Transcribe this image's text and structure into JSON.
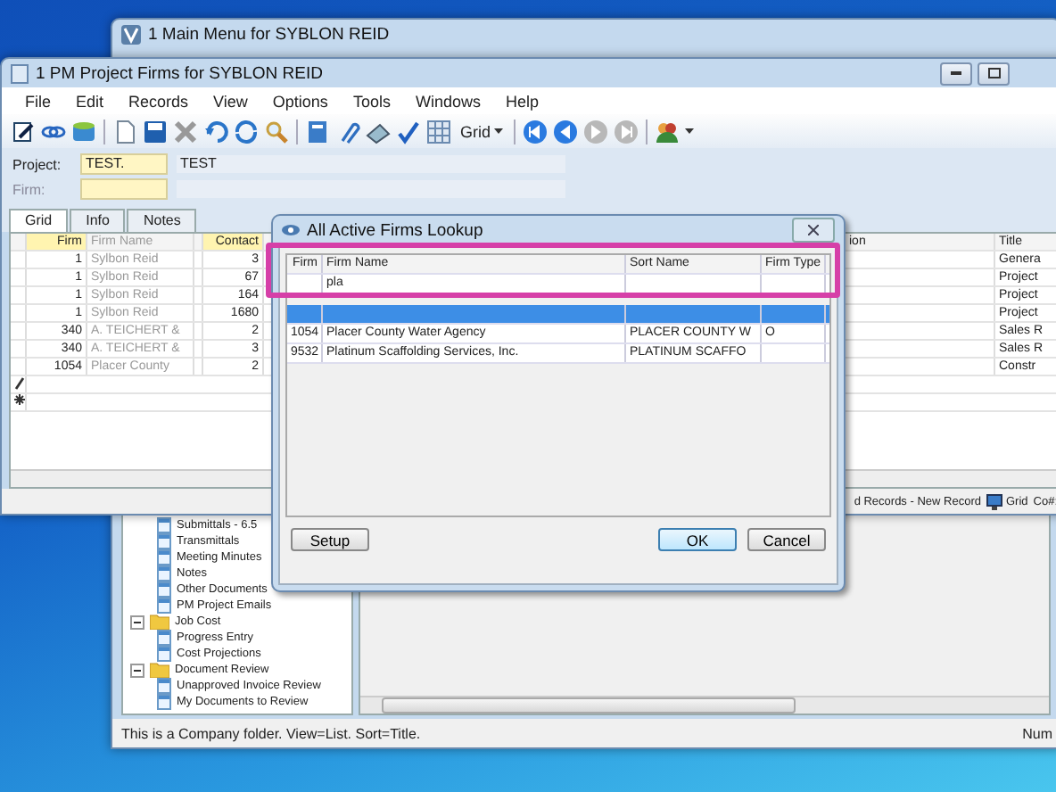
{
  "main_window": {
    "title": "1 Main Menu for SYBLON REID",
    "tree": [
      {
        "label": "Submittals - 6.5",
        "kind": "document"
      },
      {
        "label": "Transmittals",
        "kind": "document"
      },
      {
        "label": "Meeting Minutes",
        "kind": "document"
      },
      {
        "label": "Notes",
        "kind": "document"
      },
      {
        "label": "Other Documents",
        "kind": "document"
      },
      {
        "label": "PM Project Emails",
        "kind": "document"
      },
      {
        "label": "Job Cost",
        "kind": "folder",
        "expanded": true,
        "children": [
          {
            "label": "Progress Entry",
            "kind": "document"
          },
          {
            "label": "Cost Projections",
            "kind": "document"
          }
        ]
      },
      {
        "label": "Document Review",
        "kind": "folder",
        "expanded": true,
        "children": [
          {
            "label": "Unapproved Invoice Review",
            "kind": "document"
          },
          {
            "label": "My Documents to Review",
            "kind": "document"
          }
        ]
      }
    ],
    "status_text": "This is a Company folder. View=List. Sort=Title.",
    "status_right": "Num"
  },
  "project_window": {
    "title": "1 PM Project Firms for SYBLON REID",
    "menu": [
      "File",
      "Edit",
      "Records",
      "View",
      "Options",
      "Tools",
      "Windows",
      "Help"
    ],
    "toolbar": {
      "view_label": "Grid"
    },
    "fields": [
      {
        "label": "Project:",
        "value": "TEST.",
        "description": "TEST",
        "disabled": false
      },
      {
        "label": "Firm:",
        "disabled": true
      }
    ],
    "tabs": [
      {
        "label": "Grid",
        "selected": true
      },
      {
        "label": "Info",
        "selected": false
      },
      {
        "label": "Notes",
        "selected": false
      }
    ],
    "grid": {
      "columns": [
        "Firm",
        "Firm Name",
        "Contact",
        "ion",
        "Title"
      ],
      "rows": [
        {
          "firm": "1",
          "firm_name": "Sylbon Reid",
          "contact": "3",
          "title": "Genera"
        },
        {
          "firm": "1",
          "firm_name": "Sylbon Reid",
          "contact": "67",
          "title": "Project"
        },
        {
          "firm": "1",
          "firm_name": "Sylbon Reid",
          "contact": "164",
          "title": "Project"
        },
        {
          "firm": "1",
          "firm_name": "Sylbon Reid",
          "contact": "1680",
          "title": "Project"
        },
        {
          "firm": "340",
          "firm_name": "A. TEICHERT &",
          "contact": "2",
          "title": "Sales R"
        },
        {
          "firm": "340",
          "firm_name": "A. TEICHERT &",
          "contact": "3",
          "title": "Sales R"
        },
        {
          "firm": "1054",
          "firm_name": "Placer County",
          "contact": "2",
          "title": "Constr"
        }
      ]
    },
    "status_bar": [
      "d Records - New Record",
      "Grid",
      "Co#:"
    ]
  },
  "lookup": {
    "title": "All Active Firms Lookup",
    "columns": [
      "Firm",
      "Firm Name",
      "Sort Name",
      "Firm Type"
    ],
    "filter": {
      "firm_name": "pla"
    },
    "rows": [
      {
        "selected": true
      },
      {
        "firm": "1054",
        "firm_name": "Placer County Water Agency",
        "sort_name": "PLACER COUNTY W",
        "firm_type": "O",
        "selected": false
      },
      {
        "firm": "9532",
        "firm_name": "Platinum Scaffolding Services, Inc.",
        "sort_name": "PLATINUM SCAFFO",
        "selected": false
      }
    ],
    "buttons": [
      {
        "label": "Setup",
        "kind": "left"
      },
      {
        "label": "OK",
        "kind": "default"
      },
      {
        "label": "Cancel",
        "kind": "normal"
      }
    ]
  }
}
